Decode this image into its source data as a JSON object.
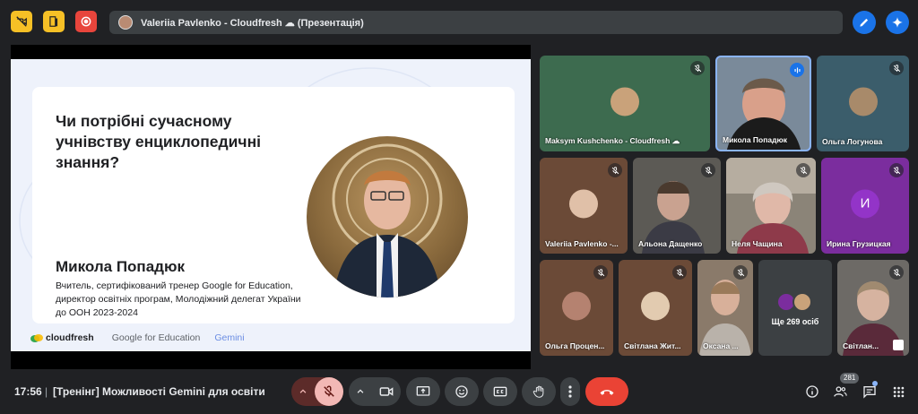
{
  "meeting": {
    "presenter_title": "Valeriia Pavlenko - Cloudfresh ☁ (Презентація)",
    "time": "17:56",
    "name": "[Тренінг] Можливості Gemini для освіти",
    "participants_badge": "281"
  },
  "slide": {
    "question": "Чи потрібні сучасному учнівству енциклопедичні знання?",
    "speaker_name": "Микола Попадюк",
    "speaker_desc": "Вчитель, сертифікований тренер Google for Education, директор освітніх програм, Молодіжний делегат України до ООН 2023-2024",
    "logo_cloudfresh": "cloudfresh",
    "logo_google": "Google for Education",
    "logo_gemini": "Gemini"
  },
  "tiles": [
    {
      "name": "Maksym Kushchenko - Cloudfresh ☁",
      "bg": "#3d6b4f"
    },
    {
      "name": "Микола Попадюк",
      "bg": "#7a8a9a"
    },
    {
      "name": "Ольга Логунова",
      "bg": "#3b5d6b"
    },
    {
      "name": "Valeriia Pavlenko -...",
      "bg": "#6b4a37"
    },
    {
      "name": "Альона Дащенко",
      "bg": "#5c5a55"
    },
    {
      "name": "Неля Чащина",
      "bg": "#8b8478"
    },
    {
      "name": "Ирина Грузицкая",
      "bg": "#7b2d9e",
      "initial": "И"
    },
    {
      "name": "Ольга Процен...",
      "bg": "#6b4a37"
    },
    {
      "name": "Світлана Жит...",
      "bg": "#6b4a37"
    },
    {
      "name": "Оксана ...",
      "bg": "#8a7a6a"
    },
    {
      "name": "Ще 269 осіб",
      "bg": "#3c4043"
    },
    {
      "name": "Світлан...",
      "bg": "#6d6a66"
    }
  ],
  "colors": {
    "end_call": "#ea4335",
    "mic_muted": "#f2b8b5",
    "accent_blue": "#1a73e8"
  }
}
